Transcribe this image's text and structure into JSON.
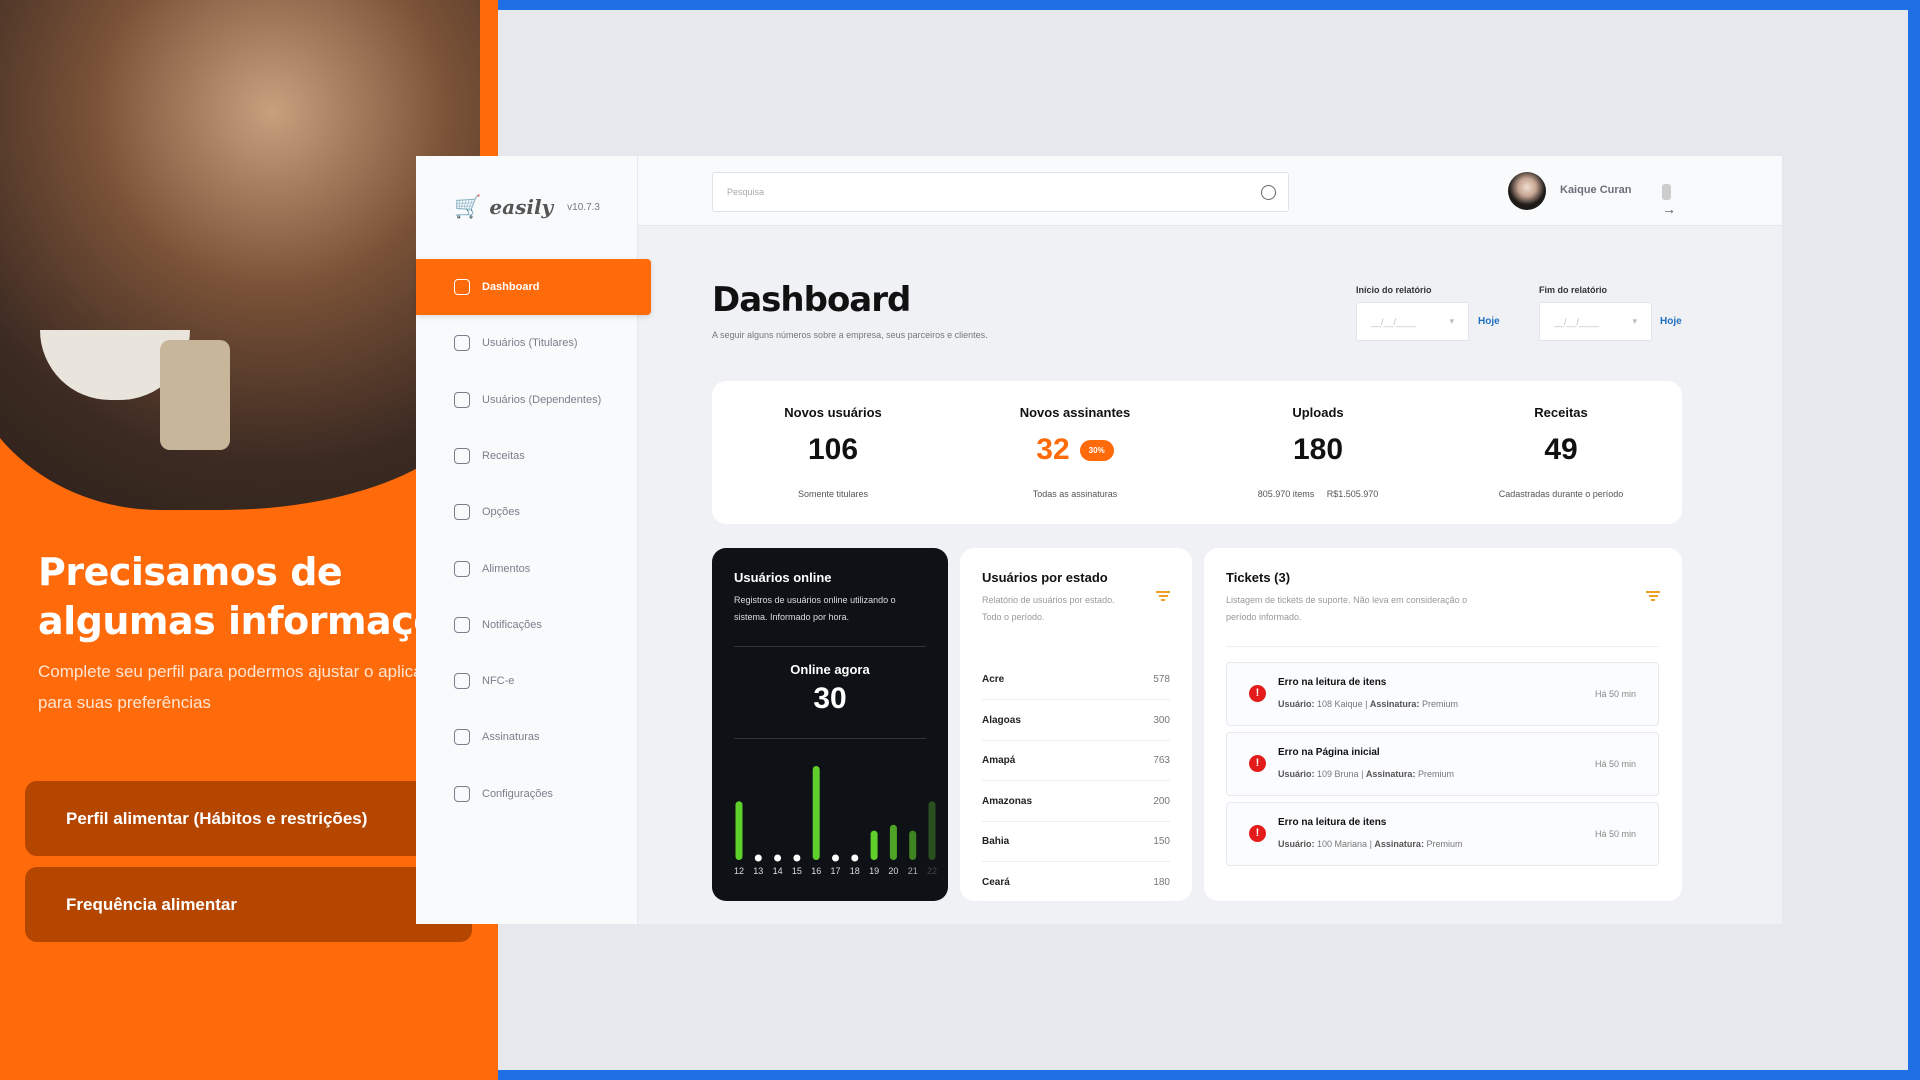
{
  "left_panel": {
    "heading_line1": "Precisamos de",
    "heading_line2": "algumas informações",
    "subtitle_line1": "Complete seu perfil para podermos ajustar o aplicativo",
    "subtitle_line2": "para suas preferências",
    "buttons": [
      {
        "label": "Perfil alimentar (Hábitos e restrições)"
      },
      {
        "label": "Frequência alimentar"
      }
    ]
  },
  "app": {
    "logo": "easily",
    "version": "v10.7.3",
    "nav": [
      {
        "label": "Dashboard",
        "icon": "dashboard-icon",
        "active": true
      },
      {
        "label": "Usuários (Titulares)",
        "icon": "user-icon"
      },
      {
        "label": "Usuários (Dependentes)",
        "icon": "users-icon"
      },
      {
        "label": "Receitas",
        "icon": "recipe-icon"
      },
      {
        "label": "Opções",
        "icon": "options-icon"
      },
      {
        "label": "Alimentos",
        "icon": "food-icon"
      },
      {
        "label": "Notificações",
        "icon": "bell-icon"
      },
      {
        "label": "NFC-e",
        "icon": "ticket-icon"
      },
      {
        "label": "Assinaturas",
        "icon": "crown-icon"
      },
      {
        "label": "Configurações",
        "icon": "settings-icon"
      }
    ],
    "search_placeholder": "Pesquisa",
    "user_name": "Kaique Curan",
    "title": "Dashboard",
    "subtitle": "A seguir alguns números sobre a empresa, seus parceiros e clientes.",
    "date_start": {
      "label": "Início do relatório",
      "placeholder": "__/__/____",
      "today": "Hoje"
    },
    "date_end": {
      "label": "Fim do relatório",
      "placeholder": "__/__/____",
      "today": "Hoje"
    },
    "stats": [
      {
        "title": "Novos usuários",
        "value": "106",
        "sub": "Somente titulares"
      },
      {
        "title": "Novos assinantes",
        "value": "32",
        "badge": "30%",
        "sub": "Todas as assinaturas"
      },
      {
        "title": "Uploads",
        "value": "180",
        "sub": "805.970 items     R$1.505.970"
      },
      {
        "title": "Receitas",
        "value": "49",
        "sub": "Cadastradas durante o período"
      }
    ],
    "online": {
      "title": "Usuários online",
      "desc": "Registros de usuários online utilizando o sistema. Informado por hora.",
      "now_label": "Online agora",
      "now_value": "30"
    },
    "states": {
      "title": "Usuários por estado",
      "desc": "Relatório de usuários por estado. Todo o período.",
      "rows": [
        {
          "name": "Acre",
          "value": "578"
        },
        {
          "name": "Alagoas",
          "value": "300"
        },
        {
          "name": "Amapá",
          "value": "763"
        },
        {
          "name": "Amazonas",
          "value": "200"
        },
        {
          "name": "Bahia",
          "value": "150"
        },
        {
          "name": "Ceará",
          "value": "180"
        }
      ]
    },
    "tickets": {
      "title": "Tickets (3)",
      "desc": "Listagem de tickets de suporte. Não leva em consideração o período informado.",
      "user_label": "Usuário:",
      "plan_label": "Assinatura:",
      "items": [
        {
          "title": "Erro na leitura de itens",
          "user": "108 Kaique",
          "plan": "Premium",
          "ago": "Há 50 min"
        },
        {
          "title": "Erro na Página inicial",
          "user": "109 Bruna",
          "plan": "Premium",
          "ago": "Há 50 min"
        },
        {
          "title": "Erro na leitura de itens",
          "user": "100 Mariana",
          "plan": "Premium",
          "ago": "Há 50 min"
        }
      ]
    }
  },
  "chart_data": {
    "type": "bar",
    "categories": [
      "12",
      "13",
      "14",
      "15",
      "16",
      "17",
      "18",
      "19",
      "20",
      "21",
      "22"
    ],
    "values": [
      10,
      0,
      0,
      0,
      16,
      0,
      0,
      5,
      6,
      5,
      10
    ],
    "colors": [
      "#5fcf2c",
      "#fff",
      "#fff",
      "#fff",
      "#5fcf2c",
      "#fff",
      "#fff",
      "#5fcf2c",
      "#4ea525",
      "#3f8420",
      "#2a4f1e"
    ]
  },
  "colors": {
    "accent": "#ff6a0a",
    "frame": "#1f6fe5",
    "error": "#e31b1b",
    "link": "#1f6fbf"
  }
}
